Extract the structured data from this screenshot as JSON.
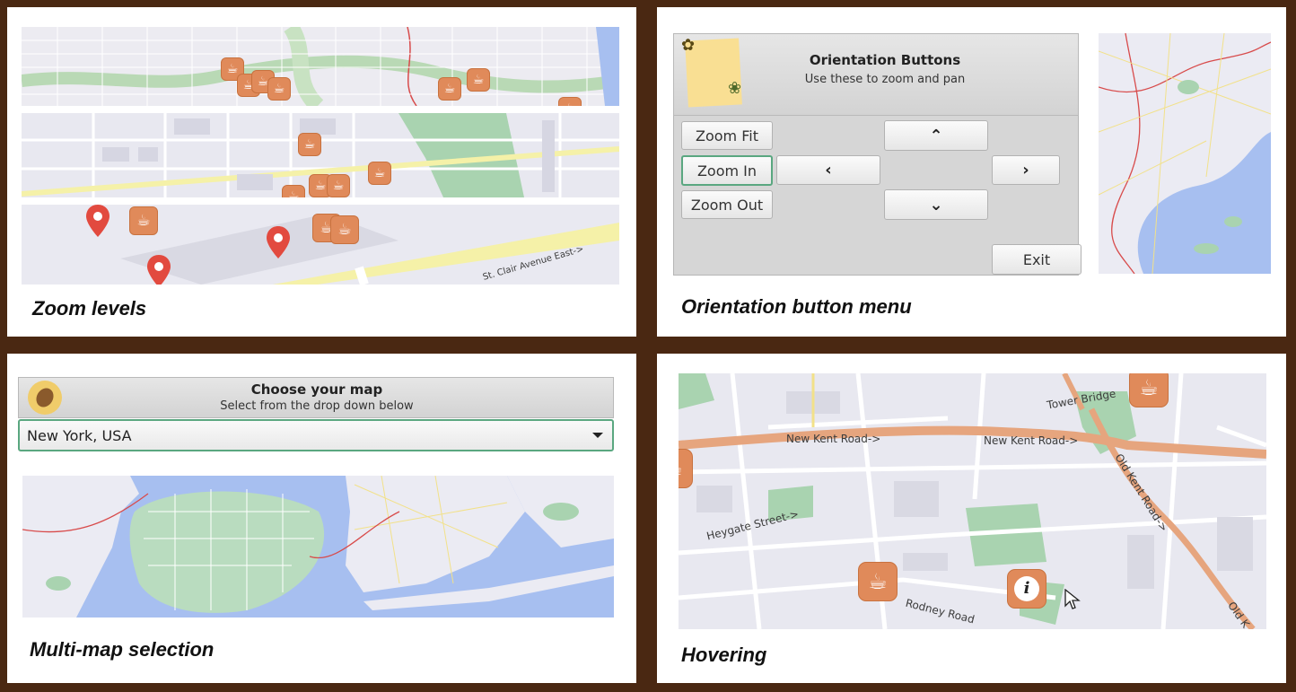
{
  "captions": {
    "zoom": "Zoom levels",
    "orientation": "Orientation button menu",
    "multimap": "Multi-map selection",
    "hover": "Hovering"
  },
  "zoom_panel": {
    "street_label": "St. Clair Avenue East->"
  },
  "orientation_dialog": {
    "title": "Orientation Buttons",
    "subtitle": "Use these to zoom and pan",
    "zoom_fit": "Zoom Fit",
    "zoom_in": "Zoom In",
    "zoom_out": "Zoom Out",
    "up": "⌃",
    "down": "⌄",
    "left": "‹",
    "right": "›",
    "exit": "Exit"
  },
  "map_select": {
    "title": "Choose your map",
    "subtitle": "Select from the drop down below",
    "selected": "New York, USA"
  },
  "hover_map": {
    "roads": [
      "New Kent Road->",
      "New Kent Road->",
      "Tower Bridge",
      "Old Kent Road->",
      "Heygate Street->",
      "Rodney Road",
      "Old K"
    ]
  },
  "colors": {
    "background": "#4a2812",
    "marker": "#e08a5a",
    "pin": "#e24a3f",
    "focus": "#5aa780",
    "water": "#a7bff0",
    "park": "#a9d3b0"
  }
}
